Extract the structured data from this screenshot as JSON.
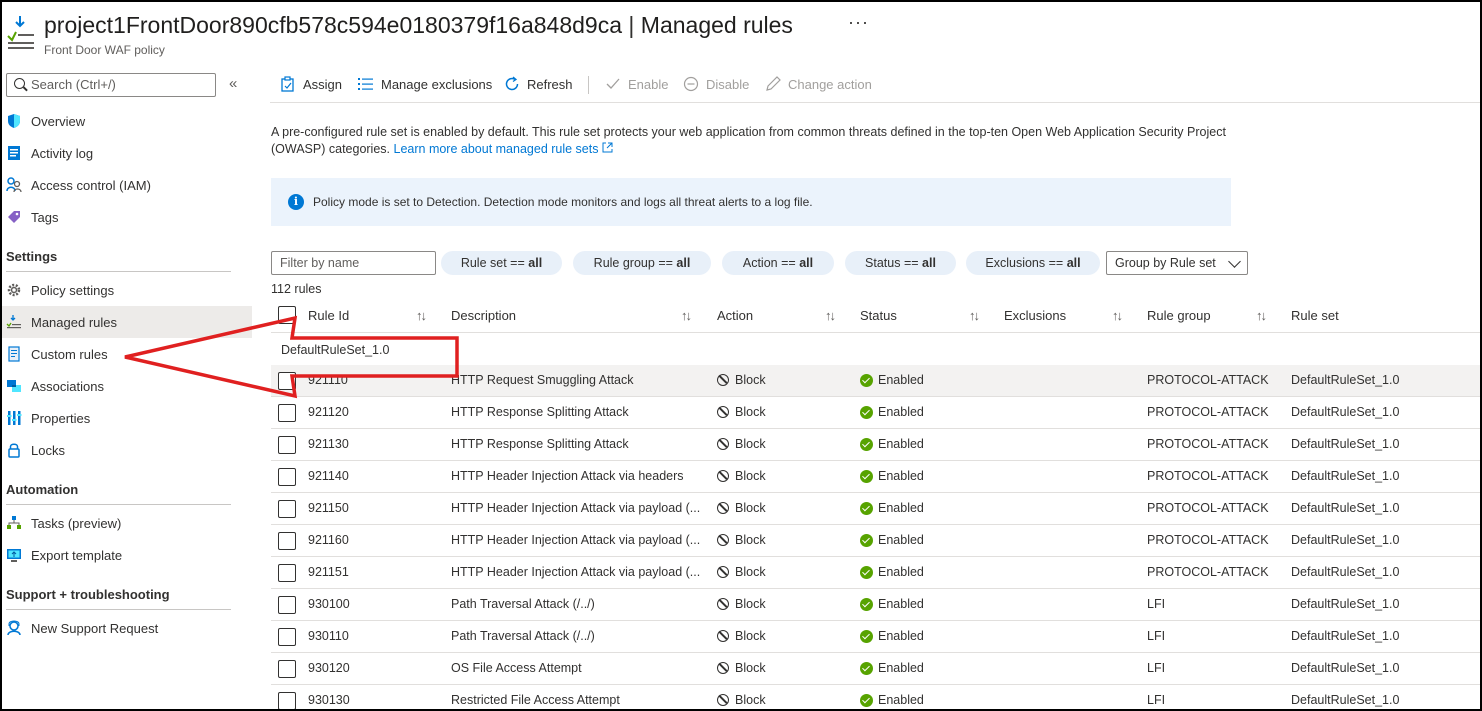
{
  "header": {
    "resource_name": "project1FrontDoor890cfb578c594e0180379f16a848d9ca",
    "separator": "|",
    "blade_title": "Managed rules",
    "subtitle": "Front Door WAF policy",
    "more": "···"
  },
  "sidebar": {
    "search_placeholder": "Search (Ctrl+/)",
    "collapse": "«",
    "items_top": [
      {
        "label": "Overview",
        "icon": "shield-icon"
      },
      {
        "label": "Activity log",
        "icon": "activity-log-icon"
      },
      {
        "label": "Access control (IAM)",
        "icon": "people-icon"
      },
      {
        "label": "Tags",
        "icon": "tag-icon"
      }
    ],
    "settings_title": "Settings",
    "settings_items": [
      {
        "label": "Policy settings",
        "icon": "gear-icon"
      },
      {
        "label": "Managed rules",
        "icon": "managed-rules-icon",
        "active": true
      },
      {
        "label": "Custom rules",
        "icon": "document-icon"
      },
      {
        "label": "Associations",
        "icon": "associations-icon"
      },
      {
        "label": "Properties",
        "icon": "properties-icon"
      },
      {
        "label": "Locks",
        "icon": "lock-icon"
      }
    ],
    "automation_title": "Automation",
    "automation_items": [
      {
        "label": "Tasks (preview)",
        "icon": "tasks-icon"
      },
      {
        "label": "Export template",
        "icon": "export-icon"
      }
    ],
    "support_title": "Support + troubleshooting",
    "support_items": [
      {
        "label": "New Support Request",
        "icon": "support-icon"
      }
    ]
  },
  "toolbar": {
    "assign": "Assign",
    "manage_exclusions": "Manage exclusions",
    "refresh": "Refresh",
    "enable": "Enable",
    "disable": "Disable",
    "change_action": "Change action"
  },
  "description": {
    "text": "A pre-configured rule set is enabled by default. This rule set protects your web application from common threats defined in the top-ten Open Web Application Security Project (OWASP) categories.",
    "link": "Learn more about managed rule sets"
  },
  "info_banner": "Policy mode is set to Detection. Detection mode monitors and logs all threat alerts to a log file.",
  "filters": {
    "name_placeholder": "Filter by name",
    "pills": [
      {
        "key": "Rule set",
        "op": "==",
        "value": "all"
      },
      {
        "key": "Rule group",
        "op": "==",
        "value": "all"
      },
      {
        "key": "Action",
        "op": "==",
        "value": "all"
      },
      {
        "key": "Status",
        "op": "==",
        "value": "all"
      },
      {
        "key": "Exclusions",
        "op": "==",
        "value": "all"
      }
    ],
    "group_by": "Group by Rule set"
  },
  "rule_count": "112 rules",
  "table": {
    "columns": [
      "Rule Id",
      "Description",
      "Action",
      "Status",
      "Exclusions",
      "Rule group",
      "Rule set"
    ],
    "sort_icon": "↑↓",
    "group_label": "DefaultRuleSet_1.0",
    "rows": [
      {
        "id": "921110",
        "desc": "HTTP Request Smuggling Attack",
        "action": "Block",
        "status": "Enabled",
        "exclusions": "",
        "group": "PROTOCOL-ATTACK",
        "set": "DefaultRuleSet_1.0"
      },
      {
        "id": "921120",
        "desc": "HTTP Response Splitting Attack",
        "action": "Block",
        "status": "Enabled",
        "exclusions": "",
        "group": "PROTOCOL-ATTACK",
        "set": "DefaultRuleSet_1.0"
      },
      {
        "id": "921130",
        "desc": "HTTP Response Splitting Attack",
        "action": "Block",
        "status": "Enabled",
        "exclusions": "",
        "group": "PROTOCOL-ATTACK",
        "set": "DefaultRuleSet_1.0"
      },
      {
        "id": "921140",
        "desc": "HTTP Header Injection Attack via headers",
        "action": "Block",
        "status": "Enabled",
        "exclusions": "",
        "group": "PROTOCOL-ATTACK",
        "set": "DefaultRuleSet_1.0"
      },
      {
        "id": "921150",
        "desc": "HTTP Header Injection Attack via payload (...",
        "action": "Block",
        "status": "Enabled",
        "exclusions": "",
        "group": "PROTOCOL-ATTACK",
        "set": "DefaultRuleSet_1.0"
      },
      {
        "id": "921160",
        "desc": "HTTP Header Injection Attack via payload (...",
        "action": "Block",
        "status": "Enabled",
        "exclusions": "",
        "group": "PROTOCOL-ATTACK",
        "set": "DefaultRuleSet_1.0"
      },
      {
        "id": "921151",
        "desc": "HTTP Header Injection Attack via payload (...",
        "action": "Block",
        "status": "Enabled",
        "exclusions": "",
        "group": "PROTOCOL-ATTACK",
        "set": "DefaultRuleSet_1.0"
      },
      {
        "id": "930100",
        "desc": "Path Traversal Attack (/../)",
        "action": "Block",
        "status": "Enabled",
        "exclusions": "",
        "group": "LFI",
        "set": "DefaultRuleSet_1.0"
      },
      {
        "id": "930110",
        "desc": "Path Traversal Attack (/../)",
        "action": "Block",
        "status": "Enabled",
        "exclusions": "",
        "group": "LFI",
        "set": "DefaultRuleSet_1.0"
      },
      {
        "id": "930120",
        "desc": "OS File Access Attempt",
        "action": "Block",
        "status": "Enabled",
        "exclusions": "",
        "group": "LFI",
        "set": "DefaultRuleSet_1.0"
      },
      {
        "id": "930130",
        "desc": "Restricted File Access Attempt",
        "action": "Block",
        "status": "Enabled",
        "exclusions": "",
        "group": "LFI",
        "set": "DefaultRuleSet_1.0"
      }
    ]
  },
  "colors": {
    "accent": "#0078d4",
    "annotation": "#e02020",
    "enabled": "#57a300",
    "info_bg": "#ebf3fc"
  }
}
